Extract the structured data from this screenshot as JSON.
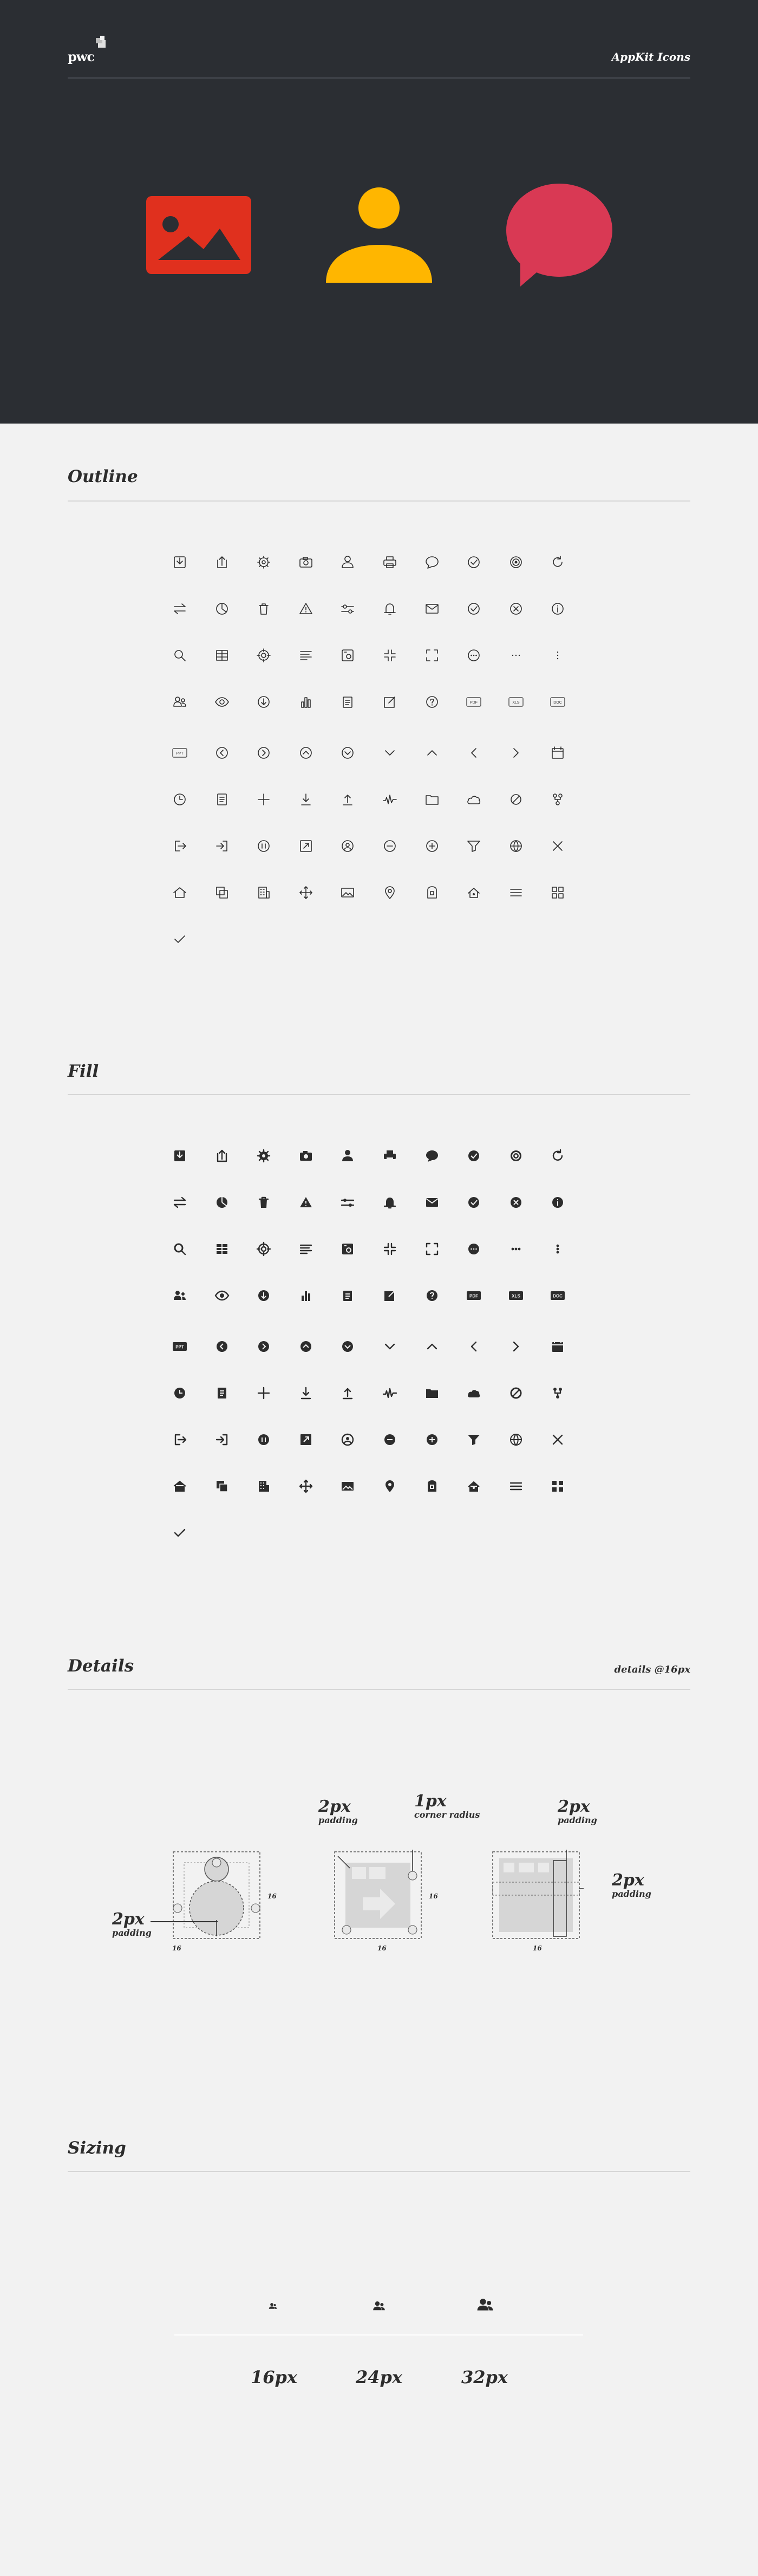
{
  "header": {
    "logo_text": "pwc",
    "title": "AppKit Icons"
  },
  "hero_icons": [
    {
      "name": "image-icon",
      "color": "#e0301e"
    },
    {
      "name": "user-icon",
      "color": "#ffb600"
    },
    {
      "name": "chat-icon",
      "color": "#d93954"
    }
  ],
  "sections": {
    "outline": {
      "title": "Outline"
    },
    "fill": {
      "title": "Fill"
    },
    "details": {
      "title": "Details",
      "note": "details @16px"
    },
    "sizing": {
      "title": "Sizing"
    }
  },
  "icon_rows": [
    [
      "download",
      "upload",
      "gear",
      "camera",
      "person",
      "printer",
      "chat",
      "check-circle",
      "target",
      "refresh"
    ],
    [
      "transfer",
      "pie-chart",
      "trash",
      "warning",
      "sliders",
      "bell",
      "mail",
      "check-badge",
      "close-circle",
      "info"
    ],
    [
      "search",
      "table",
      "crosshair",
      "paragraph",
      "media-box",
      "collapse",
      "expand",
      "more-circle",
      "more-horizontal",
      "more-vertical"
    ],
    [
      "group",
      "view",
      "arrow-down-circle",
      "bar-chart",
      "clipboard",
      "edit",
      "help",
      "pdf",
      "xls",
      "doc"
    ],
    [
      "ppt",
      "circle-left",
      "circle-right",
      "circle-up",
      "circle-down",
      "chevron-down",
      "chevron-up",
      "chevron-left",
      "chevron-right",
      "calendar"
    ],
    [
      "clock",
      "document",
      "plus",
      "download-arrow",
      "upload-arrow",
      "pulse",
      "folder",
      "cloud",
      "blocked",
      "tree"
    ],
    [
      "logout",
      "login",
      "pause",
      "open-external",
      "user-circle",
      "minus-circle",
      "plus-circle",
      "filter",
      "globe",
      "close"
    ],
    [
      "home",
      "copy",
      "building",
      "move",
      "image",
      "location",
      "locked-door",
      "home-smart",
      "menu",
      "grid"
    ],
    [
      "checkmark"
    ]
  ],
  "icon_labels": {
    "pdf": "PDF",
    "xls": "XLS",
    "doc": "DOC",
    "ppt": "PPT"
  },
  "details": {
    "dimension": "16",
    "labels": {
      "padding_a": {
        "value": "2px",
        "caption": "padding"
      },
      "padding_b": {
        "value": "2px",
        "caption": "padding"
      },
      "corner": {
        "value": "1px",
        "caption": "corner radius"
      },
      "padding_c": {
        "value": "2px",
        "caption": "padding"
      },
      "padding_d": {
        "value": "2px",
        "caption": "padding"
      }
    }
  },
  "sizing": {
    "labels": [
      "16px",
      "24px",
      "32px"
    ]
  },
  "colors": {
    "hero_bg": "#2b2e33",
    "page_bg": "#f2f2f2",
    "icon": "#2d2d2d",
    "rule": "#d6d6d6"
  }
}
